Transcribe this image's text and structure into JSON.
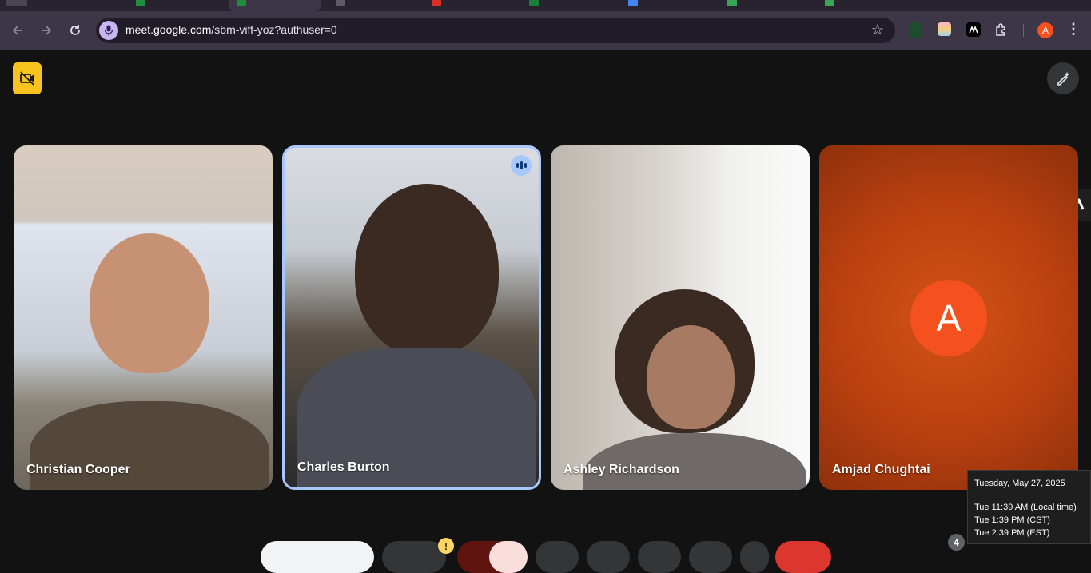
{
  "browser": {
    "url_host": "meet.google.com",
    "url_path": "/sbm-viff-yoz?authuser=0",
    "profile_initial": "A",
    "extensions": [
      "green-extension-icon",
      "colorful-extension-icon",
      "m-extension-icon",
      "puzzle-extension-icon"
    ]
  },
  "meeting": {
    "participants": [
      {
        "name": "Christian Cooper",
        "speaking": false
      },
      {
        "name": "Charles Burton",
        "speaking": true
      },
      {
        "name": "Ashley Richardson",
        "speaking": false
      },
      {
        "name": "Amjad Chughtai",
        "speaking": false,
        "avatar_initial": "A"
      }
    ],
    "participant_count": "4",
    "avatar_color": "#f4511e",
    "active_speaker_border": "#a8c7fa"
  },
  "tooltip": {
    "date": "Tuesday, May 27, 2025",
    "local": "Tue 11:39 AM (Local time)",
    "cst": "Tue 1:39 PM (CST)",
    "est": "Tue 2:39 PM (EST)"
  },
  "warning_badge": "!"
}
